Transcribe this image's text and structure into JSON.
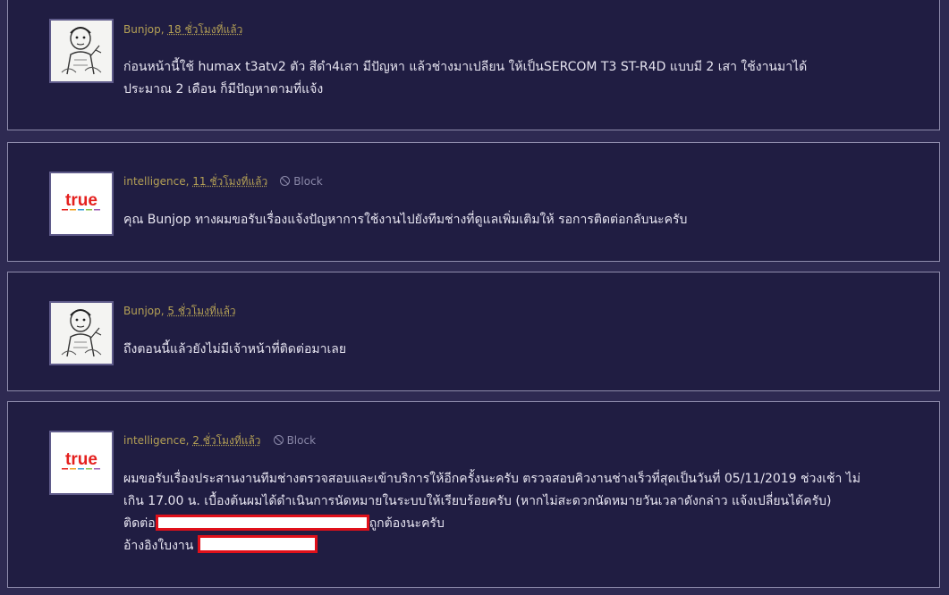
{
  "posts": [
    {
      "avatar": "user-sketch-avatar",
      "author": "Bunjop",
      "time": "18 ชั่วโมงที่แล้ว",
      "show_block": false,
      "lines": [
        "ก่อนหน้านี้ใช้ humax t3atv2 ตัว สีดำ4เสา มีปัญหา แล้วช่างมาเปลียน ให้เป็นSERCOM T3 ST-R4D แบบมี 2 เสา ใช้งานมาได้",
        "ประมาณ 2 เดือน ก็มีปัญหาตามที่แจ้ง"
      ]
    },
    {
      "avatar": "true-logo-avatar",
      "author": "intelligence",
      "time": "11 ชั่วโมงที่แล้ว",
      "show_block": true,
      "lines": [
        "คุณ Bunjop  ทางผมขอรับเรื่องแจ้งปัญหาการใช้งานไปยังทีมช่างที่ดูแลเพิ่มเติมให้ รอการติดต่อกลับนะครับ"
      ]
    },
    {
      "avatar": "user-sketch-avatar",
      "author": "Bunjop",
      "time": "5 ชั่วโมงที่แล้ว",
      "show_block": false,
      "lines": [
        "ถึงตอนนี้แล้วยังไม่มีเจ้าหน้าที่ติดต่อมาเลย"
      ]
    },
    {
      "avatar": "true-logo-avatar",
      "author": "intelligence",
      "time": "2 ชั่วโมงที่แล้ว",
      "show_block": true,
      "lines": [
        "ผมขอรับเรื่องประสานงานทีมช่างตรวจสอบและเข้าบริการให้อีกครั้งนะครับ ตรวจสอบคิวงานช่างเร็วที่สุดเป็นวันที่ 05/11/2019 ช่วงเช้า ไม่",
        "เกิน 17.00 น. เบื้องต้นผมได้ดำเนินการนัดหมายในระบบให้เรียบร้อยครับ (หากไม่สะดวกนัดหมายวันเวลาดังกล่าว แจ้งเปลี่ยนได้ครับ)"
      ],
      "contact_prefix": "ติดต่อ",
      "contact_suffix": "ถูกต้องนะครับ",
      "ref_prefix": "อ้างอิงใบงาน"
    }
  ],
  "block_label": "Block",
  "logo_text": "true",
  "colors": {
    "page_bg": "#2e2a52",
    "card_bg": "#201d42",
    "card_border": "#8f8cac",
    "author": "#b4a055",
    "redact_border": "#e0101a",
    "true_red": "#e4201e"
  }
}
